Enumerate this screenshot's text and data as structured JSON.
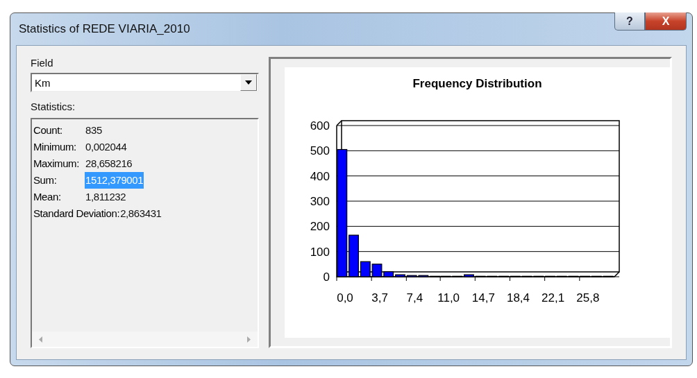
{
  "window": {
    "title": "Statistics of REDE VIARIA_2010",
    "buttons": [
      {
        "kind": "help",
        "label": "?"
      },
      {
        "kind": "close",
        "label": "X"
      }
    ]
  },
  "field": {
    "label": "Field",
    "value": "Km"
  },
  "statistics": {
    "label": "Statistics:",
    "rows": [
      {
        "label": "Count:",
        "value": "835",
        "selected": false
      },
      {
        "label": "Minimum:",
        "value": "0,002044",
        "selected": false
      },
      {
        "label": "Maximum:",
        "value": "28,658216",
        "selected": false
      },
      {
        "label": "Sum:",
        "value": "1512,379001",
        "selected": true
      },
      {
        "label": "Mean:",
        "value": "1,811232",
        "selected": false
      },
      {
        "label": "Standard Deviation:",
        "value": "2,863431",
        "selected": false
      }
    ]
  },
  "chart": {
    "chart_data": {
      "type": "bar",
      "title": "Frequency Distribution",
      "x": [
        0,
        1.23,
        2.47,
        3.7,
        4.93,
        6.17,
        7.4,
        8.63,
        9.87,
        11.0,
        12.23,
        13.47,
        14.7,
        15.93,
        17.17,
        18.4,
        19.63,
        20.87,
        22.1,
        23.33,
        24.57,
        25.8,
        27.03,
        28.27
      ],
      "series": [
        {
          "color": "#0000ff",
          "values": [
            505,
            165,
            60,
            50,
            20,
            8,
            5,
            5,
            2,
            2,
            2,
            8,
            2,
            2,
            2,
            2,
            2,
            2,
            2,
            2,
            2,
            2,
            2,
            2
          ]
        }
      ],
      "xlim": [
        0,
        29.5
      ],
      "ylim": [
        0,
        600
      ],
      "grid": true,
      "yticks": [
        0,
        100,
        200,
        300,
        400,
        500,
        600
      ],
      "xticks": [
        {
          "value": 0,
          "label": "0,0"
        },
        {
          "value": 3.7,
          "label": "3,7"
        },
        {
          "value": 7.4,
          "label": "7,4"
        },
        {
          "value": 11.0,
          "label": "11,0"
        },
        {
          "value": 14.7,
          "label": "14,7"
        },
        {
          "value": 18.4,
          "label": "18,4"
        },
        {
          "value": 22.1,
          "label": "22,1"
        },
        {
          "value": 25.8,
          "label": "25,8"
        }
      ]
    }
  }
}
